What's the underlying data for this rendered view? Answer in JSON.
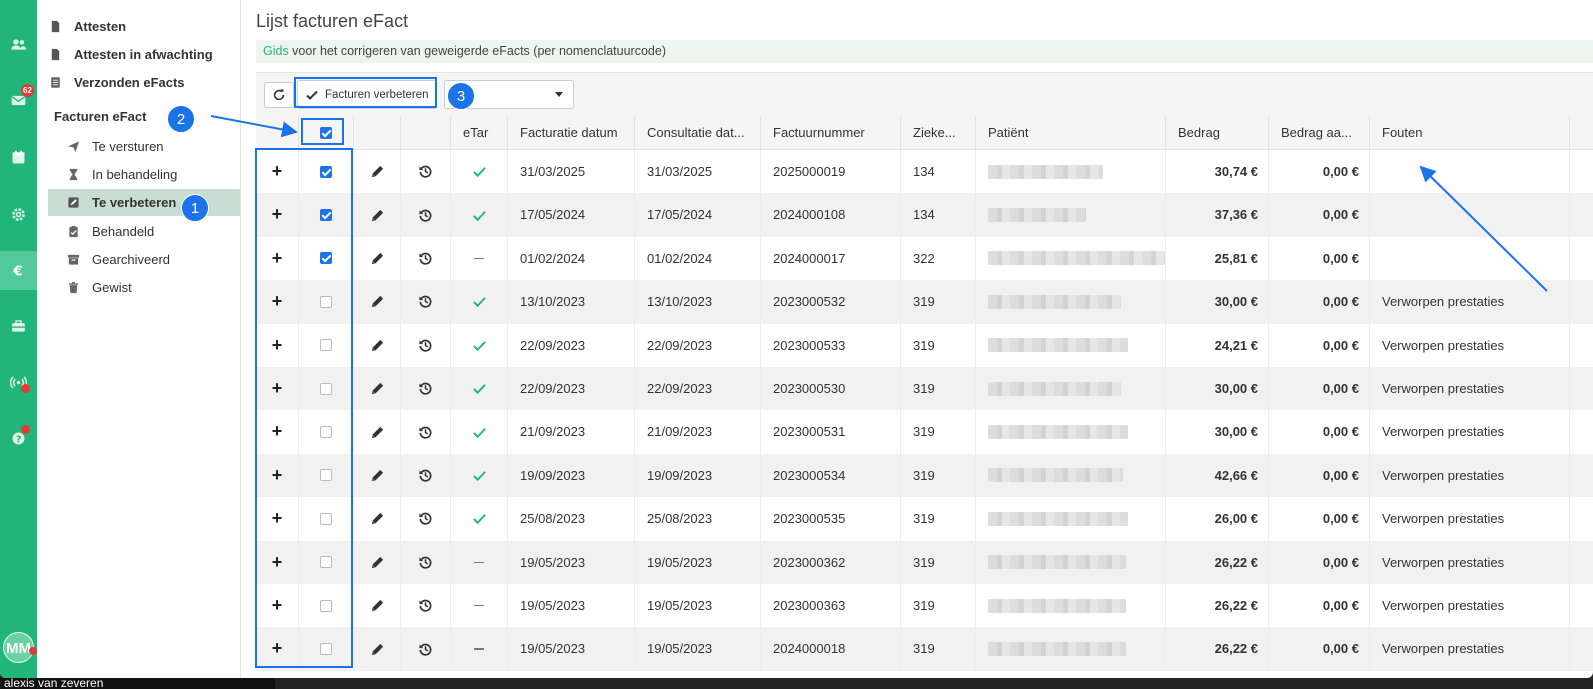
{
  "rail": {
    "mail_badge": "62",
    "avatar_initials": "MM",
    "icons": [
      "users-icon",
      "mail-icon",
      "calendar-icon",
      "settings-icon",
      "euro-icon",
      "briefcase-icon",
      "broadcast-icon",
      "help-icon"
    ],
    "active_index": 4
  },
  "subnav": {
    "top_items": [
      {
        "label": "Attesten",
        "icon": "file-icon"
      },
      {
        "label": "Attesten in afwachting",
        "icon": "file-icon"
      },
      {
        "label": "Verzonden eFacts",
        "icon": "list-icon"
      }
    ],
    "heading": "Facturen eFact",
    "items": [
      {
        "label": "Te versturen",
        "icon": "send-icon"
      },
      {
        "label": "In behandeling",
        "icon": "hourglass-icon"
      },
      {
        "label": "Te verbeteren",
        "icon": "edit-icon",
        "active": true
      },
      {
        "label": "Behandeld",
        "icon": "clipboard-check-icon"
      },
      {
        "label": "Gearchiveerd",
        "icon": "archive-icon"
      },
      {
        "label": "Gewist",
        "icon": "trash-icon"
      }
    ]
  },
  "main": {
    "title": "Lijst facturen eFact",
    "guide": {
      "link": "Gids",
      "text": " voor het corrigeren van geweigerde eFacts (per nomenclatuurcode)"
    },
    "toolbar": {
      "improve_label": "Facturen verbeteren",
      "select_value": ""
    }
  },
  "table": {
    "headers": [
      "eTar",
      "Facturatie datum",
      "Consultatie dat...",
      "Factuurnummer",
      "Zieke...",
      "Patiënt",
      "Bedrag",
      "Bedrag aa...",
      "Fouten"
    ],
    "rows": [
      {
        "checked": true,
        "etar": "check",
        "fact_date": "31/03/2025",
        "cons_date": "31/03/2025",
        "number": "2025000019",
        "zieke": "134",
        "bedrag": "30,74 €",
        "bedrag_aa": "0,00 €",
        "fouten": "",
        "patient_w": 115
      },
      {
        "checked": true,
        "etar": "check",
        "fact_date": "17/05/2024",
        "cons_date": "17/05/2024",
        "number": "2024000108",
        "zieke": "134",
        "bedrag": "37,36 €",
        "bedrag_aa": "0,00 €",
        "fouten": "",
        "patient_w": 98
      },
      {
        "checked": true,
        "etar": "dash",
        "fact_date": "01/02/2024",
        "cons_date": "01/02/2024",
        "number": "2024000017",
        "zieke": "322",
        "bedrag": "25,81 €",
        "bedrag_aa": "0,00 €",
        "fouten": "",
        "patient_w": 178
      },
      {
        "checked": false,
        "etar": "check",
        "fact_date": "13/10/2023",
        "cons_date": "13/10/2023",
        "number": "2023000532",
        "zieke": "319",
        "bedrag": "30,00 €",
        "bedrag_aa": "0,00 €",
        "fouten": "Verworpen prestaties",
        "patient_w": 133
      },
      {
        "checked": false,
        "etar": "check",
        "fact_date": "22/09/2023",
        "cons_date": "22/09/2023",
        "number": "2023000533",
        "zieke": "319",
        "bedrag": "24,21 €",
        "bedrag_aa": "0,00 €",
        "fouten": "Verworpen prestaties",
        "patient_w": 140
      },
      {
        "checked": false,
        "etar": "check",
        "fact_date": "22/09/2023",
        "cons_date": "22/09/2023",
        "number": "2023000530",
        "zieke": "319",
        "bedrag": "30,00 €",
        "bedrag_aa": "0,00 €",
        "fouten": "Verworpen prestaties",
        "patient_w": 133
      },
      {
        "checked": false,
        "etar": "check",
        "fact_date": "21/09/2023",
        "cons_date": "21/09/2023",
        "number": "2023000531",
        "zieke": "319",
        "bedrag": "30,00 €",
        "bedrag_aa": "0,00 €",
        "fouten": "Verworpen prestaties",
        "patient_w": 140
      },
      {
        "checked": false,
        "etar": "check",
        "fact_date": "19/09/2023",
        "cons_date": "19/09/2023",
        "number": "2023000534",
        "zieke": "319",
        "bedrag": "42,66 €",
        "bedrag_aa": "0,00 €",
        "fouten": "Verworpen prestaties",
        "patient_w": 135
      },
      {
        "checked": false,
        "etar": "check",
        "fact_date": "25/08/2023",
        "cons_date": "25/08/2023",
        "number": "2023000535",
        "zieke": "319",
        "bedrag": "26,00 €",
        "bedrag_aa": "0,00 €",
        "fouten": "Verworpen prestaties",
        "patient_w": 140
      },
      {
        "checked": false,
        "etar": "dash",
        "fact_date": "19/05/2023",
        "cons_date": "19/05/2023",
        "number": "2023000362",
        "zieke": "319",
        "bedrag": "26,22 €",
        "bedrag_aa": "0,00 €",
        "fouten": "Verworpen prestaties",
        "patient_w": 138
      },
      {
        "checked": false,
        "etar": "dash",
        "fact_date": "19/05/2023",
        "cons_date": "19/05/2023",
        "number": "2023000363",
        "zieke": "319",
        "bedrag": "26,22 €",
        "bedrag_aa": "0,00 €",
        "fouten": "Verworpen prestaties",
        "patient_w": 138
      },
      {
        "checked": false,
        "etar": "dash",
        "fact_date": "19/05/2023",
        "cons_date": "19/05/2023",
        "number": "2024000018",
        "zieke": "319",
        "bedrag": "26,22 €",
        "bedrag_aa": "0,00 €",
        "fouten": "Verworpen prestaties",
        "patient_w": 138
      }
    ]
  },
  "annotations": {
    "labels": [
      "1",
      "2",
      "3"
    ],
    "color": "#1a73e8"
  },
  "footer": {
    "caption": "alexis van zeveren"
  },
  "colors": {
    "brand": "#21b57a",
    "accent": "#1a73e8"
  }
}
